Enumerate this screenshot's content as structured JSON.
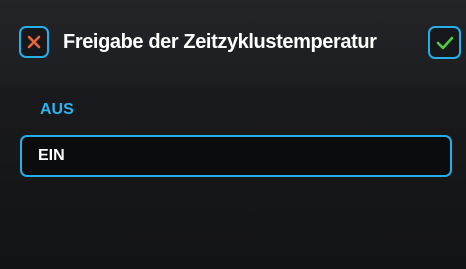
{
  "dialog": {
    "title": "Freigabe der Zeitzyklustemperatur",
    "cancel_icon": "close-icon",
    "confirm_icon": "checkmark-icon"
  },
  "options": [
    {
      "label": "AUS",
      "selected": false
    },
    {
      "label": "EIN",
      "selected": true
    }
  ],
  "colors": {
    "accent": "#25aee8",
    "cancel": "#e8663c",
    "confirm": "#52c943",
    "background": "#1a1b1e"
  }
}
